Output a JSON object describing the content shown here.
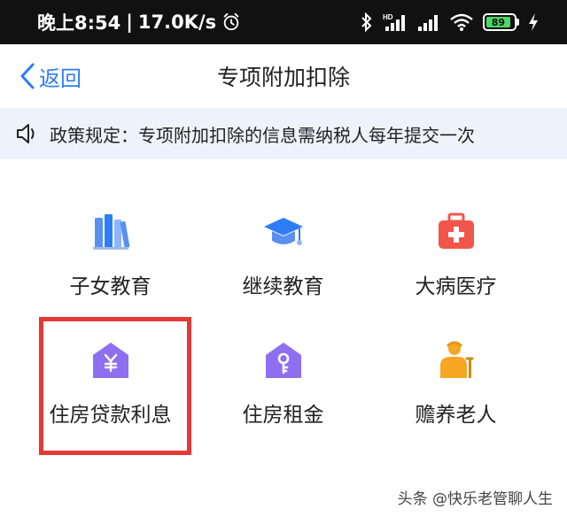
{
  "status_bar": {
    "time_prefix": "晚上8:54",
    "separator": "|",
    "network_speed": "17.0K/s",
    "battery_level": "89",
    "icons": [
      "alarm-icon",
      "bluetooth-icon",
      "hd-signal-icon",
      "signal-icon",
      "wifi-icon",
      "battery-icon",
      "charging-icon"
    ],
    "hd_label": "HD"
  },
  "nav": {
    "back_label": "返回",
    "title": "专项附加扣除"
  },
  "notice": {
    "icon": "speaker-icon",
    "text": "政策规定：专项附加扣除的信息需纳税人每年提交一次"
  },
  "categories": [
    {
      "label": "子女教育",
      "icon": "books-icon"
    },
    {
      "label": "继续教育",
      "icon": "graduation-cap-icon"
    },
    {
      "label": "大病医疗",
      "icon": "first-aid-kit-icon"
    },
    {
      "label": "住房贷款利息",
      "icon": "house-yuan-icon"
    },
    {
      "label": "住房租金",
      "icon": "house-key-icon"
    },
    {
      "label": "赡养老人",
      "icon": "elderly-person-icon"
    }
  ],
  "colors": {
    "accent": "#2e7df6",
    "notice_bg": "#eef3fb",
    "highlight": "#e53935",
    "house_purple": "#8e6ff0",
    "medical_red": "#f0564a",
    "elderly_orange": "#f5a623"
  },
  "watermark": "头条 @快乐老管聊人生"
}
